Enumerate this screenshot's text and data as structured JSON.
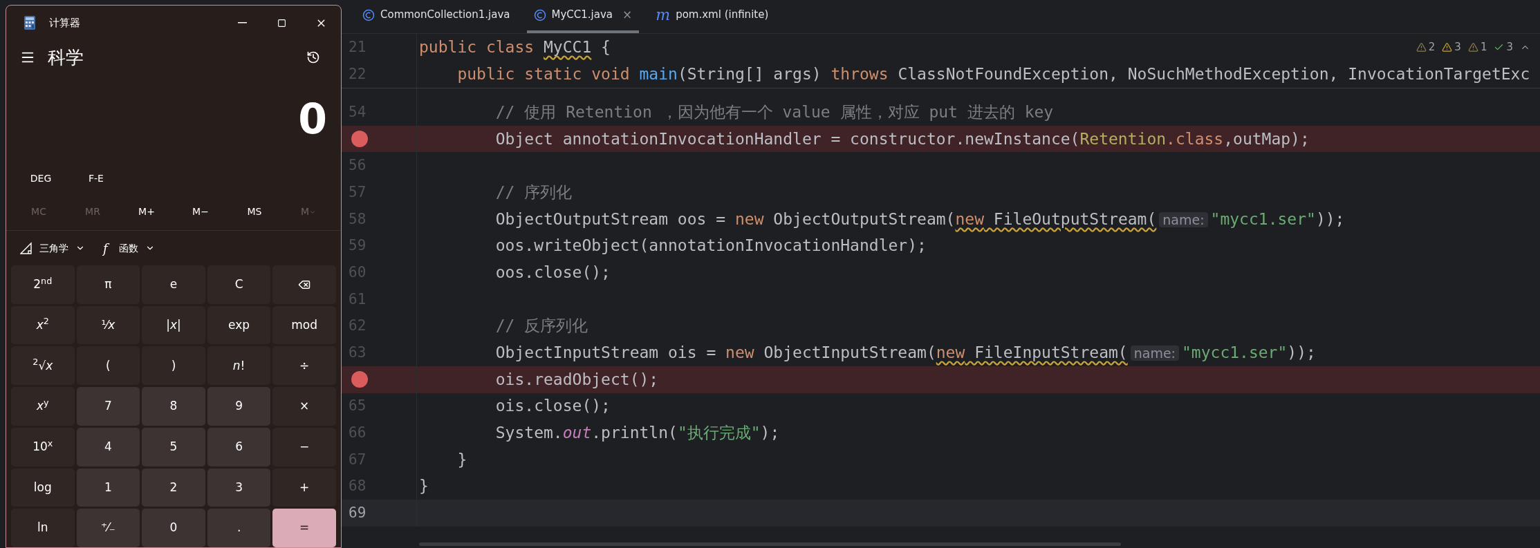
{
  "calculator": {
    "title": "计算器",
    "mode": "科学",
    "display": "0",
    "toggles": [
      "DEG",
      "F-E"
    ],
    "memory": [
      {
        "label": "MC",
        "disabled": true
      },
      {
        "label": "MR",
        "disabled": true
      },
      {
        "label": "M+",
        "disabled": false
      },
      {
        "label": "M−",
        "disabled": false
      },
      {
        "label": "MS",
        "disabled": false
      },
      {
        "label": "M",
        "disabled": true,
        "dropdown": true
      }
    ],
    "dropdowns": [
      {
        "kind": "trig",
        "label": "三角学"
      },
      {
        "kind": "func",
        "glyph": "f",
        "label": "函数"
      }
    ],
    "keys": [
      {
        "kind": "func",
        "label": "2$^{nd}$"
      },
      {
        "kind": "func",
        "label": "π"
      },
      {
        "kind": "func",
        "label": "e"
      },
      {
        "kind": "func",
        "label": "C"
      },
      {
        "kind": "backspace"
      },
      {
        "kind": "func",
        "label": "*x*$^{2}$"
      },
      {
        "kind": "func",
        "label": "¹⁄*x*"
      },
      {
        "kind": "func",
        "label": "|*x*|"
      },
      {
        "kind": "func",
        "label": "exp"
      },
      {
        "kind": "func",
        "label": "mod"
      },
      {
        "kind": "func",
        "label": "$^{2}$√*x*"
      },
      {
        "kind": "func",
        "label": "("
      },
      {
        "kind": "func",
        "label": ")"
      },
      {
        "kind": "func",
        "label": "*n*!"
      },
      {
        "kind": "func",
        "label": "÷"
      },
      {
        "kind": "func",
        "label": "*x*$^{y}$"
      },
      {
        "kind": "digit",
        "label": "7"
      },
      {
        "kind": "digit",
        "label": "8"
      },
      {
        "kind": "digit",
        "label": "9"
      },
      {
        "kind": "func",
        "label": "×"
      },
      {
        "kind": "func",
        "label": "10$^{x}$"
      },
      {
        "kind": "digit",
        "label": "4"
      },
      {
        "kind": "digit",
        "label": "5"
      },
      {
        "kind": "digit",
        "label": "6"
      },
      {
        "kind": "func",
        "label": "−"
      },
      {
        "kind": "func",
        "label": "log"
      },
      {
        "kind": "digit",
        "label": "1"
      },
      {
        "kind": "digit",
        "label": "2"
      },
      {
        "kind": "digit",
        "label": "3"
      },
      {
        "kind": "func",
        "label": "+"
      },
      {
        "kind": "func",
        "label": "ln"
      },
      {
        "kind": "digit",
        "label": "⁺⁄₋"
      },
      {
        "kind": "digit",
        "label": "0"
      },
      {
        "kind": "digit",
        "label": "."
      },
      {
        "kind": "equals",
        "label": "="
      }
    ]
  },
  "editor": {
    "tabs": [
      {
        "kind": "class",
        "label": "CommonCollection1.java",
        "selected": false
      },
      {
        "kind": "class",
        "label": "MyCC1.java",
        "selected": true,
        "close": "×"
      },
      {
        "kind": "maven",
        "icon_text": "m",
        "label": "pom.xml (infinite)",
        "selected": false
      }
    ],
    "inspections": [
      {
        "kind": "weak",
        "count": "2"
      },
      {
        "kind": "warning",
        "count": "3"
      },
      {
        "kind": "weak",
        "count": "1"
      },
      {
        "kind": "typo",
        "count": "3"
      }
    ],
    "sticky_lines": [
      {
        "number": "21",
        "tokens": [
          {
            "kind": "kw",
            "s": "public class "
          },
          {
            "kind": "plain",
            "s": "MyCC1",
            "squiggle": true
          },
          {
            "kind": "plain",
            "s": " {"
          }
        ]
      },
      {
        "number": "22",
        "tokens": [
          {
            "kind": "kw",
            "s": "    public static void "
          },
          {
            "kind": "method",
            "s": "main"
          },
          {
            "kind": "plain",
            "s": "(String[] args) "
          },
          {
            "kind": "kw",
            "s": "throws "
          },
          {
            "kind": "plain",
            "s": "ClassNotFoundException, NoSuchMethodException, InvocationTargetExc"
          }
        ]
      }
    ],
    "lines": [
      {
        "number": "54",
        "breakpoint": false,
        "current": false,
        "tokens": [
          {
            "kind": "comment",
            "s": "        // 使用 Retention ，因为他有一个 value 属性，对应 put 进去的 key"
          }
        ]
      },
      {
        "breakpoint": true,
        "current": false,
        "tokens": [
          {
            "kind": "plain",
            "s": "        Object annotationInvocationHandler = constructor.newInstance("
          },
          {
            "kind": "yellow",
            "s": "Retention"
          },
          {
            "kind": "kw",
            "s": ".class"
          },
          {
            "kind": "plain",
            "s": ",outMap);"
          }
        ]
      },
      {
        "number": "56",
        "breakpoint": false,
        "current": false
      },
      {
        "number": "57",
        "breakpoint": false,
        "current": false,
        "tokens": [
          {
            "kind": "comment",
            "s": "        // 序列化"
          }
        ]
      },
      {
        "number": "58",
        "breakpoint": false,
        "current": false,
        "tokens": [
          {
            "kind": "plain",
            "s": "        ObjectOutputStream oos = "
          },
          {
            "kind": "kw",
            "s": "new "
          },
          {
            "kind": "plain",
            "s": "ObjectOutputStream("
          },
          {
            "kind": "kw",
            "s": "new",
            "squiggle": true
          },
          {
            "kind": "plain",
            "s": " FileOutputStream(",
            "squiggle": true
          },
          {
            "kind": "hint",
            "s": "name:"
          },
          {
            "kind": "str",
            "s": "\"mycc1.ser\""
          },
          {
            "kind": "plain",
            "s": "));"
          }
        ]
      },
      {
        "number": "59",
        "breakpoint": false,
        "current": false,
        "tokens": [
          {
            "kind": "plain",
            "s": "        oos.writeObject(annotationInvocationHandler);"
          }
        ]
      },
      {
        "number": "60",
        "breakpoint": false,
        "current": false,
        "tokens": [
          {
            "kind": "plain",
            "s": "        oos.close();"
          }
        ]
      },
      {
        "number": "61",
        "breakpoint": false,
        "current": false
      },
      {
        "number": "62",
        "breakpoint": false,
        "current": false,
        "tokens": [
          {
            "kind": "comment",
            "s": "        // 反序列化"
          }
        ]
      },
      {
        "number": "63",
        "breakpoint": false,
        "current": false,
        "tokens": [
          {
            "kind": "plain",
            "s": "        ObjectInputStream ois = "
          },
          {
            "kind": "kw",
            "s": "new "
          },
          {
            "kind": "plain",
            "s": "ObjectInputStream("
          },
          {
            "kind": "kw",
            "s": "new",
            "squiggle": true
          },
          {
            "kind": "plain",
            "s": " FileInputStream(",
            "squiggle": true
          },
          {
            "kind": "hint",
            "s": "name:"
          },
          {
            "kind": "str",
            "s": "\"mycc1.ser\""
          },
          {
            "kind": "plain",
            "s": "));"
          }
        ]
      },
      {
        "breakpoint": true,
        "current": false,
        "tokens": [
          {
            "kind": "plain",
            "s": "        ois.readObject();"
          }
        ]
      },
      {
        "number": "65",
        "breakpoint": false,
        "current": false,
        "tokens": [
          {
            "kind": "plain",
            "s": "        ois.close();"
          }
        ]
      },
      {
        "number": "66",
        "breakpoint": false,
        "current": false,
        "tokens": [
          {
            "kind": "plain",
            "s": "        System."
          },
          {
            "kind": "field",
            "s": "out"
          },
          {
            "kind": "plain",
            "s": ".println("
          },
          {
            "kind": "str",
            "s": "\"执行完成\""
          },
          {
            "kind": "plain",
            "s": ");"
          }
        ]
      },
      {
        "number": "67",
        "breakpoint": false,
        "current": false,
        "tokens": [
          {
            "kind": "plain",
            "s": "    }"
          }
        ]
      },
      {
        "number": "68",
        "breakpoint": false,
        "current": false,
        "tokens": [
          {
            "kind": "plain",
            "s": "}"
          }
        ]
      },
      {
        "number": "69",
        "breakpoint": false,
        "current": true
      }
    ]
  }
}
